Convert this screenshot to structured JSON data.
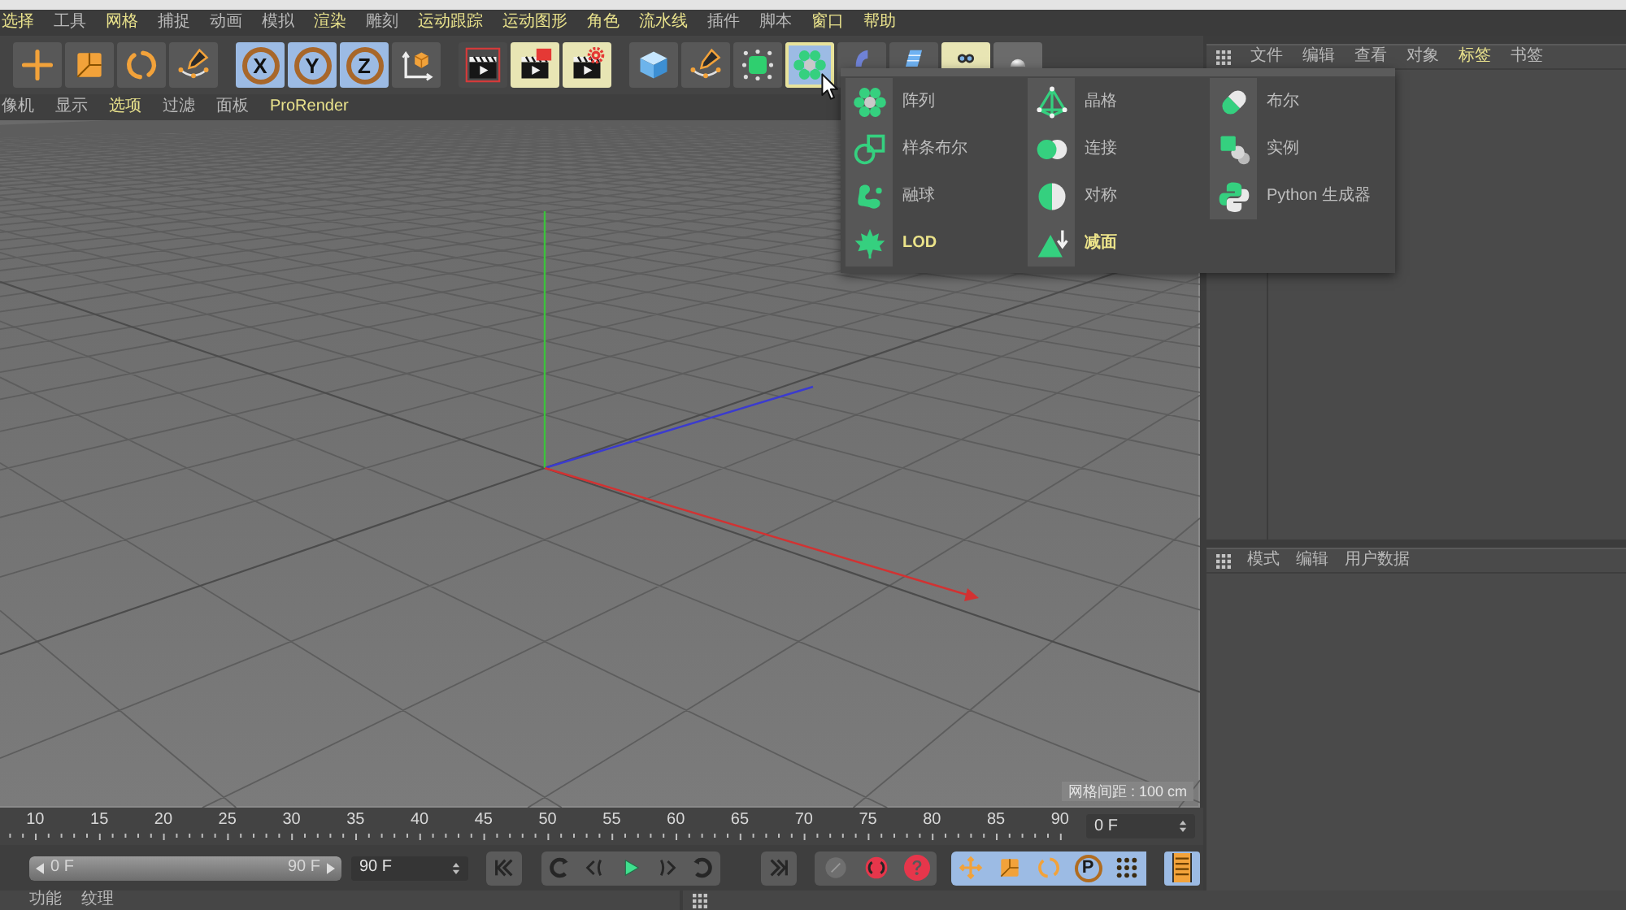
{
  "menu_bar": {
    "items": [
      {
        "label": "选择",
        "highlighted": true
      },
      {
        "label": "工具",
        "highlighted": false
      },
      {
        "label": "网格",
        "highlighted": true
      },
      {
        "label": "捕捉",
        "highlighted": false
      },
      {
        "label": "动画",
        "highlighted": false
      },
      {
        "label": "模拟",
        "highlighted": false
      },
      {
        "label": "渲染",
        "highlighted": true
      },
      {
        "label": "雕刻",
        "highlighted": false
      },
      {
        "label": "运动跟踪",
        "highlighted": true
      },
      {
        "label": "运动图形",
        "highlighted": true
      },
      {
        "label": "角色",
        "highlighted": true
      },
      {
        "label": "流水线",
        "highlighted": true
      },
      {
        "label": "插件",
        "highlighted": false
      },
      {
        "label": "脚本",
        "highlighted": false
      },
      {
        "label": "窗口",
        "highlighted": true
      },
      {
        "label": "帮助",
        "highlighted": true
      }
    ]
  },
  "toolbar": {
    "groups": [
      {
        "buttons": [
          {
            "kind": "move",
            "active": false,
            "selected": false
          },
          {
            "kind": "scale",
            "active": false,
            "selected": false
          },
          {
            "kind": "rotate",
            "active": false,
            "selected": false
          },
          {
            "kind": "spline-pen",
            "active": false,
            "selected": false
          }
        ]
      },
      {
        "buttons": [
          {
            "kind": "axis",
            "label": "X",
            "active": true,
            "selected": false
          },
          {
            "kind": "axis",
            "label": "Y",
            "active": true,
            "selected": false
          },
          {
            "kind": "axis",
            "label": "Z",
            "active": true,
            "selected": false
          },
          {
            "kind": "coordinate-system",
            "active": false,
            "selected": false
          }
        ]
      },
      {
        "buttons": [
          {
            "kind": "render-view",
            "active": false,
            "selected": false
          },
          {
            "kind": "render-picture",
            "active": false,
            "selected": false
          },
          {
            "kind": "render-settings",
            "active": false,
            "selected": false
          }
        ]
      },
      {
        "buttons": [
          {
            "kind": "cube",
            "active": false,
            "selected": false
          },
          {
            "kind": "spline-pen",
            "active": false,
            "selected": false
          },
          {
            "kind": "polygon-cube",
            "active": false,
            "selected": false
          },
          {
            "kind": "cloner",
            "active": true,
            "selected": true
          },
          {
            "kind": "deformer",
            "active": false,
            "selected": false
          },
          {
            "kind": "floor",
            "active": false,
            "selected": false
          },
          {
            "kind": "camera",
            "active": false,
            "selected": false
          },
          {
            "kind": "light",
            "active": false,
            "selected": false
          }
        ]
      }
    ]
  },
  "dropdown": {
    "columns": [
      {
        "items": [
          {
            "label": "阵列",
            "kind": "cloner",
            "highlighted": false
          },
          {
            "label": "样条布尔",
            "kind": "spline-boolean",
            "highlighted": false
          },
          {
            "label": "融球",
            "kind": "metaball",
            "highlighted": false
          },
          {
            "label": "LOD",
            "kind": "lod",
            "highlighted": true
          }
        ]
      },
      {
        "items": [
          {
            "label": "晶格",
            "kind": "lattice",
            "highlighted": false
          },
          {
            "label": "连接",
            "kind": "connect",
            "highlighted": false
          },
          {
            "label": "对称",
            "kind": "symmetry",
            "highlighted": false
          },
          {
            "label": "减面",
            "kind": "polygon-reduction",
            "highlighted": true
          }
        ]
      },
      {
        "items": [
          {
            "label": "布尔",
            "kind": "boolean",
            "highlighted": false
          },
          {
            "label": "实例",
            "kind": "instance",
            "highlighted": false
          },
          {
            "label": "Python 生成器",
            "kind": "python",
            "highlighted": false
          }
        ]
      }
    ]
  },
  "viewport": {
    "menu": [
      {
        "label": "像机",
        "highlighted": false
      },
      {
        "label": "显示",
        "highlighted": false
      },
      {
        "label": "选项",
        "highlighted": true
      },
      {
        "label": "过滤",
        "highlighted": false
      },
      {
        "label": "面板",
        "highlighted": false
      },
      {
        "label": "ProRender",
        "highlighted": true
      }
    ],
    "grid_spacing": "网格间距 : 100 cm"
  },
  "object_manager": {
    "menu": [
      {
        "label": "文件",
        "highlighted": false
      },
      {
        "label": "编辑",
        "highlighted": false
      },
      {
        "label": "查看",
        "highlighted": false
      },
      {
        "label": "对象",
        "highlighted": false
      },
      {
        "label": "标签",
        "highlighted": true
      },
      {
        "label": "书签",
        "highlighted": false
      }
    ]
  },
  "attribute_manager": {
    "menu": [
      "模式",
      "编辑",
      "用户数据"
    ]
  },
  "timeline": {
    "ticks": [
      "10",
      "15",
      "20",
      "25",
      "30",
      "35",
      "40",
      "45",
      "50",
      "55",
      "60",
      "65",
      "70",
      "75",
      "80",
      "85",
      "90"
    ],
    "current_frame": "0 F"
  },
  "playback": {
    "range_slider": {
      "start": "0 F",
      "end": "90 F",
      "level": 1
    },
    "end_frame": "90 F",
    "transport": [
      {
        "kind": "first-frame"
      },
      {
        "kind": "previous-key"
      },
      {
        "kind": "previous-frame"
      },
      {
        "kind": "play"
      },
      {
        "kind": "next-frame"
      },
      {
        "kind": "next-key"
      },
      {
        "kind": "last-frame"
      }
    ],
    "key_tools": [
      {
        "kind": "record",
        "disabled": true
      },
      {
        "kind": "auto-key",
        "disabled": false
      },
      {
        "kind": "key-selection",
        "disabled": false
      }
    ],
    "key_filters": [
      {
        "kind": "move",
        "active": true
      },
      {
        "kind": "scale",
        "active": true
      },
      {
        "kind": "rotate",
        "active": true
      },
      {
        "kind": "parameter",
        "label": "P",
        "active": true
      },
      {
        "kind": "point-level",
        "active": true
      }
    ],
    "timeline_toggle": {
      "active": true
    }
  },
  "material_manager": {
    "menu": [
      "功能",
      "纹理"
    ]
  }
}
